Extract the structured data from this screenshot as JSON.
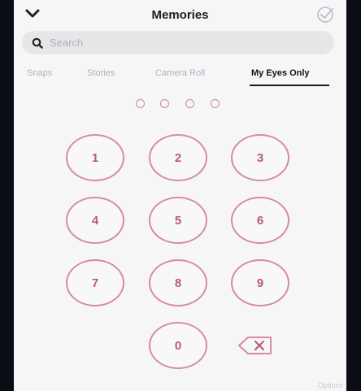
{
  "header": {
    "title": "Memories",
    "back_icon": "chevron-down-icon",
    "select_icon": "check-circle-icon"
  },
  "search": {
    "placeholder": "Search",
    "value": "",
    "icon": "search-icon"
  },
  "tabs": [
    {
      "label": "Snaps",
      "active": false
    },
    {
      "label": "Stories",
      "active": false
    },
    {
      "label": "Camera Roll",
      "active": false
    },
    {
      "label": "My Eyes Only",
      "active": true
    }
  ],
  "passcode": {
    "entered_digits": 0,
    "total_digits": 4
  },
  "keypad": {
    "keys": [
      "1",
      "2",
      "3",
      "4",
      "5",
      "6",
      "7",
      "8",
      "9",
      "0"
    ],
    "backspace_icon": "backspace-icon"
  },
  "footer": {
    "link_label": "Options"
  },
  "colors": {
    "accent": "#d58d9c",
    "digit_text": "#b85a72",
    "background": "#f6f6f8",
    "frame": "#0b0d14"
  }
}
